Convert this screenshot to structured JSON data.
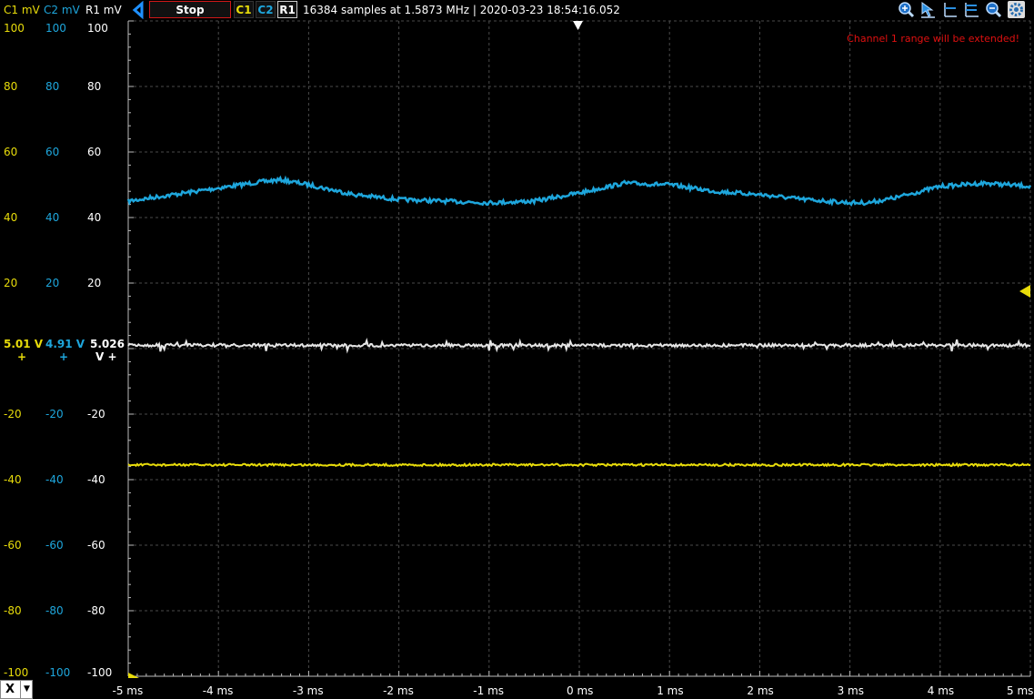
{
  "header": {
    "ch1_unit": "C1 mV",
    "ch2_unit": "C2 mV",
    "ref1_unit": "R1 mV",
    "stop_label": "Stop",
    "btn_c1": "C1",
    "btn_c2": "C2",
    "btn_r1": "R1",
    "acq_info": "16384 samples at 1.5873 MHz | 2020-03-23 18:54:16.052"
  },
  "toolbar_icons": [
    "zoom-in-icon",
    "cursor-icon",
    "hcursor-icon",
    "measure-icon",
    "zoom-out-icon",
    "settings-icon"
  ],
  "warning": "Channel 1 range will be extended!",
  "axis_menu": {
    "label": "X",
    "arrow": "▼"
  },
  "y_axis": {
    "c1_ticks": [
      "100",
      "80",
      "60",
      "40",
      "20",
      "-20",
      "-40",
      "-60",
      "-80",
      "-100"
    ],
    "c2_ticks": [
      "100",
      "80",
      "60",
      "40",
      "20",
      "-20",
      "-40",
      "-60",
      "-80",
      "-100"
    ],
    "r1_ticks": [
      "100",
      "80",
      "60",
      "40",
      "20",
      "-20",
      "-40",
      "-60",
      "-80",
      "-100"
    ],
    "offsets": {
      "c1": "5.01 V",
      "c1_sign": "+",
      "c2": "4.91 V",
      "c2_sign": "+",
      "r1": "5.026",
      "r1_sign": "V +"
    }
  },
  "colors": {
    "c1": "#e8dc0a",
    "c2": "#1ea6dc",
    "r1": "#e6e6e6",
    "grid": "#4a4a4a",
    "warning": "#e01010"
  },
  "chart_data": {
    "type": "line",
    "x_unit": "ms",
    "xlim": [
      -5,
      5
    ],
    "ylim": [
      -100,
      100
    ],
    "x_ticks": [
      "-5 ms",
      "-4 ms",
      "-3 ms",
      "-2 ms",
      "-1 ms",
      "0 ms",
      "1 ms",
      "2 ms",
      "3 ms",
      "4 ms",
      "5 ms"
    ],
    "series": [
      {
        "name": "C2",
        "x": [
          -5,
          -4.5,
          -4,
          -3.5,
          -3.3,
          -3,
          -2.5,
          -2,
          -1.5,
          -1,
          -0.5,
          0,
          0.5,
          1,
          1.5,
          2,
          2.5,
          3,
          3.2,
          3.5,
          4,
          4.5,
          5
        ],
        "y": [
          45,
          47,
          49,
          51,
          51.5,
          50,
          47,
          45.5,
          45,
          44.5,
          45,
          47.5,
          50.5,
          50,
          48,
          47,
          45.5,
          44.5,
          44.5,
          46,
          49.5,
          50.5,
          49.5
        ]
      },
      {
        "name": "R1",
        "x": [
          -5,
          5
        ],
        "y": [
          1,
          1
        ]
      },
      {
        "name": "C1",
        "x": [
          -5,
          5
        ],
        "y": [
          -35.5,
          -35.5
        ]
      }
    ]
  }
}
